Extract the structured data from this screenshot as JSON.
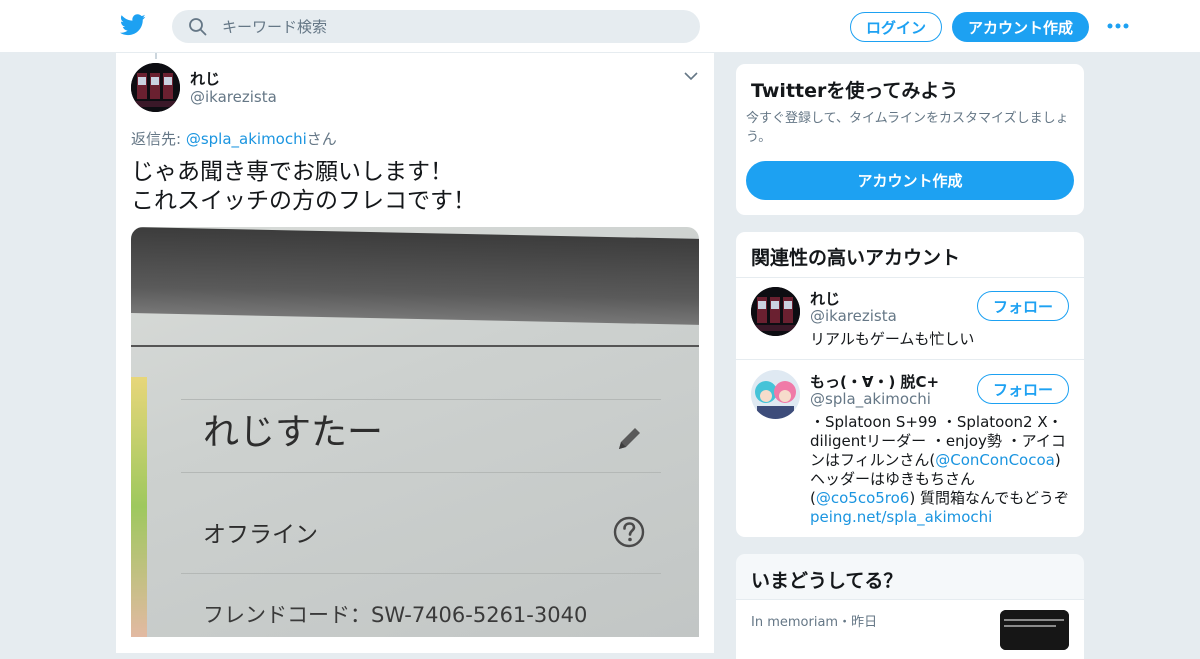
{
  "header": {
    "search_placeholder": "キーワード検索",
    "login_label": "ログイン",
    "signup_label": "アカウント作成",
    "brand_color": "#1da1f2"
  },
  "tweet": {
    "name": "れじ",
    "handle": "@ikarezista",
    "reply_prefix": "返信先: ",
    "reply_handle": "@spla_akimochi",
    "reply_suffix": "さん",
    "text_line1": "じゃあ聞き専でお願いします！",
    "text_line2": "これスイッチの方のフレコです！",
    "photo": {
      "user_name": "れじすたー",
      "status": "オフライン",
      "friend_code": "フレンドコード：SW-7406-5261-3040"
    }
  },
  "sidebar": {
    "try_card": {
      "title": "Twitterを使ってみよう",
      "description": "今すぐ登録して、タイムラインをカスタマイズしましょう。",
      "button": "アカウント作成"
    },
    "related": {
      "title": "関連性の高いアカウント",
      "accounts": [
        {
          "name": "れじ",
          "handle": "@ikarezista",
          "bio": "リアルもゲームも忙しい",
          "follow": "フォロー"
        },
        {
          "name": "もっ(・∀・) 脱C+",
          "handle": "@spla_akimochi",
          "bio_1": "・Splatoon S+99 ・Splatoon2 X・diligentリーダー ・enjoy勢 ・アイコンはフィルンさん(",
          "bio_link1": "@ConConCocoa",
          "bio_2": ") ヘッダーはゆきもちさん(",
          "bio_link2": "@co5co5ro6",
          "bio_3": ") 質問箱なんでもどうぞ",
          "bio_link3": "peing.net/spla_akimochi",
          "follow": "フォロー"
        }
      ]
    },
    "trends": {
      "title": "いまどうしてる？",
      "item_meta": "In memoriam・昨日"
    }
  }
}
